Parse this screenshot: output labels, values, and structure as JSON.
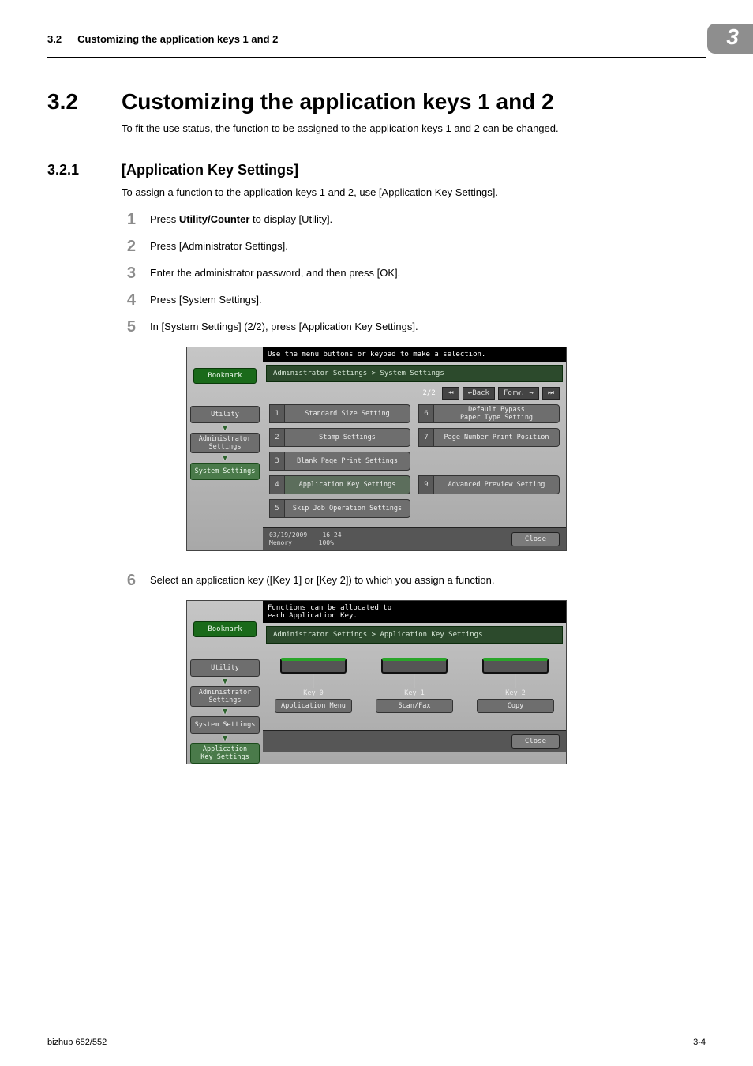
{
  "header": {
    "section_num": "3.2",
    "section_title": "Customizing the application keys 1 and 2",
    "tab_num": "3"
  },
  "h1": {
    "num": "3.2",
    "title": "Customizing the application keys 1 and 2",
    "desc": "To fit the use status, the function to be assigned to the application keys 1 and 2 can be changed."
  },
  "h2": {
    "num": "3.2.1",
    "title": "[Application Key Settings]",
    "desc": "To assign a function to the application keys 1 and 2, use [Application Key Settings]."
  },
  "steps": [
    {
      "n": "1",
      "pre": "Press ",
      "bold": "Utility/Counter",
      "post": " to display [Utility]."
    },
    {
      "n": "2",
      "pre": "Press [Administrator Settings].",
      "bold": "",
      "post": ""
    },
    {
      "n": "3",
      "pre": "Enter the administrator password, and then press [OK].",
      "bold": "",
      "post": ""
    },
    {
      "n": "4",
      "pre": "Press [System Settings].",
      "bold": "",
      "post": ""
    },
    {
      "n": "5",
      "pre": "In [System Settings] (2/2), press [Application Key Settings].",
      "bold": "",
      "post": ""
    },
    {
      "n": "6",
      "pre": "Select an application key ([Key 1] or [Key 2]) to which you assign a function.",
      "bold": "",
      "post": ""
    }
  ],
  "ss1": {
    "topmsg": "Use the menu buttons or keypad to make a selection.",
    "breadcrumb": "Administrator Settings > System Settings",
    "pager": {
      "page": "2/2",
      "back": "←Back",
      "fwd": "Forw. →"
    },
    "side": {
      "bookmark": "Bookmark",
      "utility": "Utility",
      "admin": "Administrator\nSettings",
      "system": "System Settings"
    },
    "opts": [
      {
        "n": "1",
        "t": "Standard Size Setting"
      },
      {
        "n": "6",
        "t": "Default Bypass\nPaper Type Setting"
      },
      {
        "n": "2",
        "t": "Stamp Settings"
      },
      {
        "n": "7",
        "t": "Page Number Print Position"
      },
      {
        "n": "3",
        "t": "Blank Page Print Settings"
      },
      {
        "n": "",
        "t": ""
      },
      {
        "n": "4",
        "t": "Application Key Settings"
      },
      {
        "n": "9",
        "t": "Advanced Preview Setting"
      },
      {
        "n": "5",
        "t": "Skip Job Operation Settings"
      },
      {
        "n": "",
        "t": ""
      }
    ],
    "footer": {
      "date": "03/19/2009",
      "time": "16:24",
      "mem": "Memory",
      "pct": "100%",
      "close": "Close"
    }
  },
  "ss2": {
    "topmsg": "Functions can be allocated to\neach Application Key.",
    "breadcrumb": "Administrator Settings > Application Key Settings",
    "side": {
      "bookmark": "Bookmark",
      "utility": "Utility",
      "admin": "Administrator\nSettings",
      "system": "System Settings",
      "appkey": "Application\nKey Settings"
    },
    "keys": [
      {
        "label": "Key 0",
        "value": "Application Menu"
      },
      {
        "label": "Key 1",
        "value": "Scan/Fax"
      },
      {
        "label": "Key 2",
        "value": "Copy"
      }
    ],
    "close": "Close"
  },
  "footer": {
    "left": "bizhub 652/552",
    "right": "3-4"
  }
}
